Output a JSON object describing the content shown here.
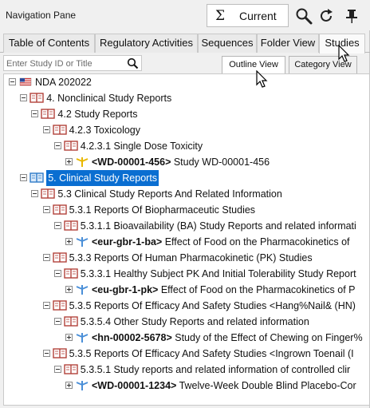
{
  "pane": {
    "title": "Navigation Pane",
    "current_label": "Current",
    "sigma": "Σ"
  },
  "tabs": [
    {
      "label": "Table of Contents"
    },
    {
      "label": "Regulatory Activities"
    },
    {
      "label": "Sequences"
    },
    {
      "label": "Folder View"
    },
    {
      "label": "Studies"
    }
  ],
  "search": {
    "placeholder": "Enter Study ID or Title"
  },
  "views": [
    {
      "label": "Outline View"
    },
    {
      "label": "Category View"
    }
  ],
  "tree": [
    {
      "text": "NDA 202022",
      "level": 0,
      "icon": "flag-icon"
    },
    {
      "text": "4. Nonclinical Study Reports",
      "level": 1,
      "icon": "book-icon"
    },
    {
      "text": "4.2 Study Reports",
      "level": 2,
      "icon": "book-icon"
    },
    {
      "text": "4.2.3 Toxicology",
      "level": 3,
      "icon": "book-icon"
    },
    {
      "text": "4.2.3.1 Single Dose Toxicity",
      "level": 4,
      "icon": "book-icon"
    },
    {
      "id": "<WD-00001-456>",
      "text": " Study WD-00001-456",
      "level": 5,
      "icon": "study-yellow-icon"
    },
    {
      "text": "5. Clinical Study Reports",
      "level": 1,
      "icon": "book-blue-icon",
      "selected": true
    },
    {
      "text": "5.3 Clinical Study Reports And Related Information",
      "level": 2,
      "icon": "book-icon"
    },
    {
      "text": "5.3.1 Reports Of Biopharmaceutic Studies",
      "level": 3,
      "icon": "book-icon"
    },
    {
      "text": "5.3.1.1 Bioavailability (BA) Study Reports and related informati",
      "level": 4,
      "icon": "book-icon"
    },
    {
      "id": "<eur-gbr-1-ba>",
      "text": " Effect of Food on the Pharmacokinetics of",
      "level": 5,
      "icon": "study-blue-icon"
    },
    {
      "text": "5.3.3 Reports Of Human Pharmacokinetic (PK) Studies",
      "level": 3,
      "icon": "book-icon"
    },
    {
      "text": "5.3.3.1 Healthy Subject PK And Initial Tolerability Study Report",
      "level": 4,
      "icon": "book-icon"
    },
    {
      "id": "<eu-gbr-1-pk>",
      "text": " Effect of Food on the Pharmacokinetics of P",
      "level": 5,
      "icon": "study-blue-icon"
    },
    {
      "text": "5.3.5 Reports Of Efficacy And Safety Studies <Hang%Nail& (HN)",
      "level": 3,
      "icon": "book-icon"
    },
    {
      "text": "5.3.5.4 Other Study Reports and related information",
      "level": 4,
      "icon": "book-icon"
    },
    {
      "id": "<hn-00002-5678>",
      "text": " Study of the Effect of Chewing on Finger%",
      "level": 5,
      "icon": "study-blue-icon"
    },
    {
      "text": "5.3.5 Reports Of Efficacy And Safety Studies <Ingrown Toenail (I",
      "level": 3,
      "icon": "book-icon"
    },
    {
      "text": "5.3.5.1 Study reports and related information of controlled clir",
      "level": 4,
      "icon": "book-icon"
    },
    {
      "id": "<WD-00001-1234>",
      "text": " Twelve-Week Double Blind Placebo-Cor",
      "level": 5,
      "icon": "study-blue-icon"
    }
  ],
  "colors": {
    "selection": "#0a6ed1",
    "book": "#b2413a",
    "book_blue": "#2f7bc8",
    "study_blue": "#4a8fd8",
    "study_yellow": "#e9b800"
  }
}
